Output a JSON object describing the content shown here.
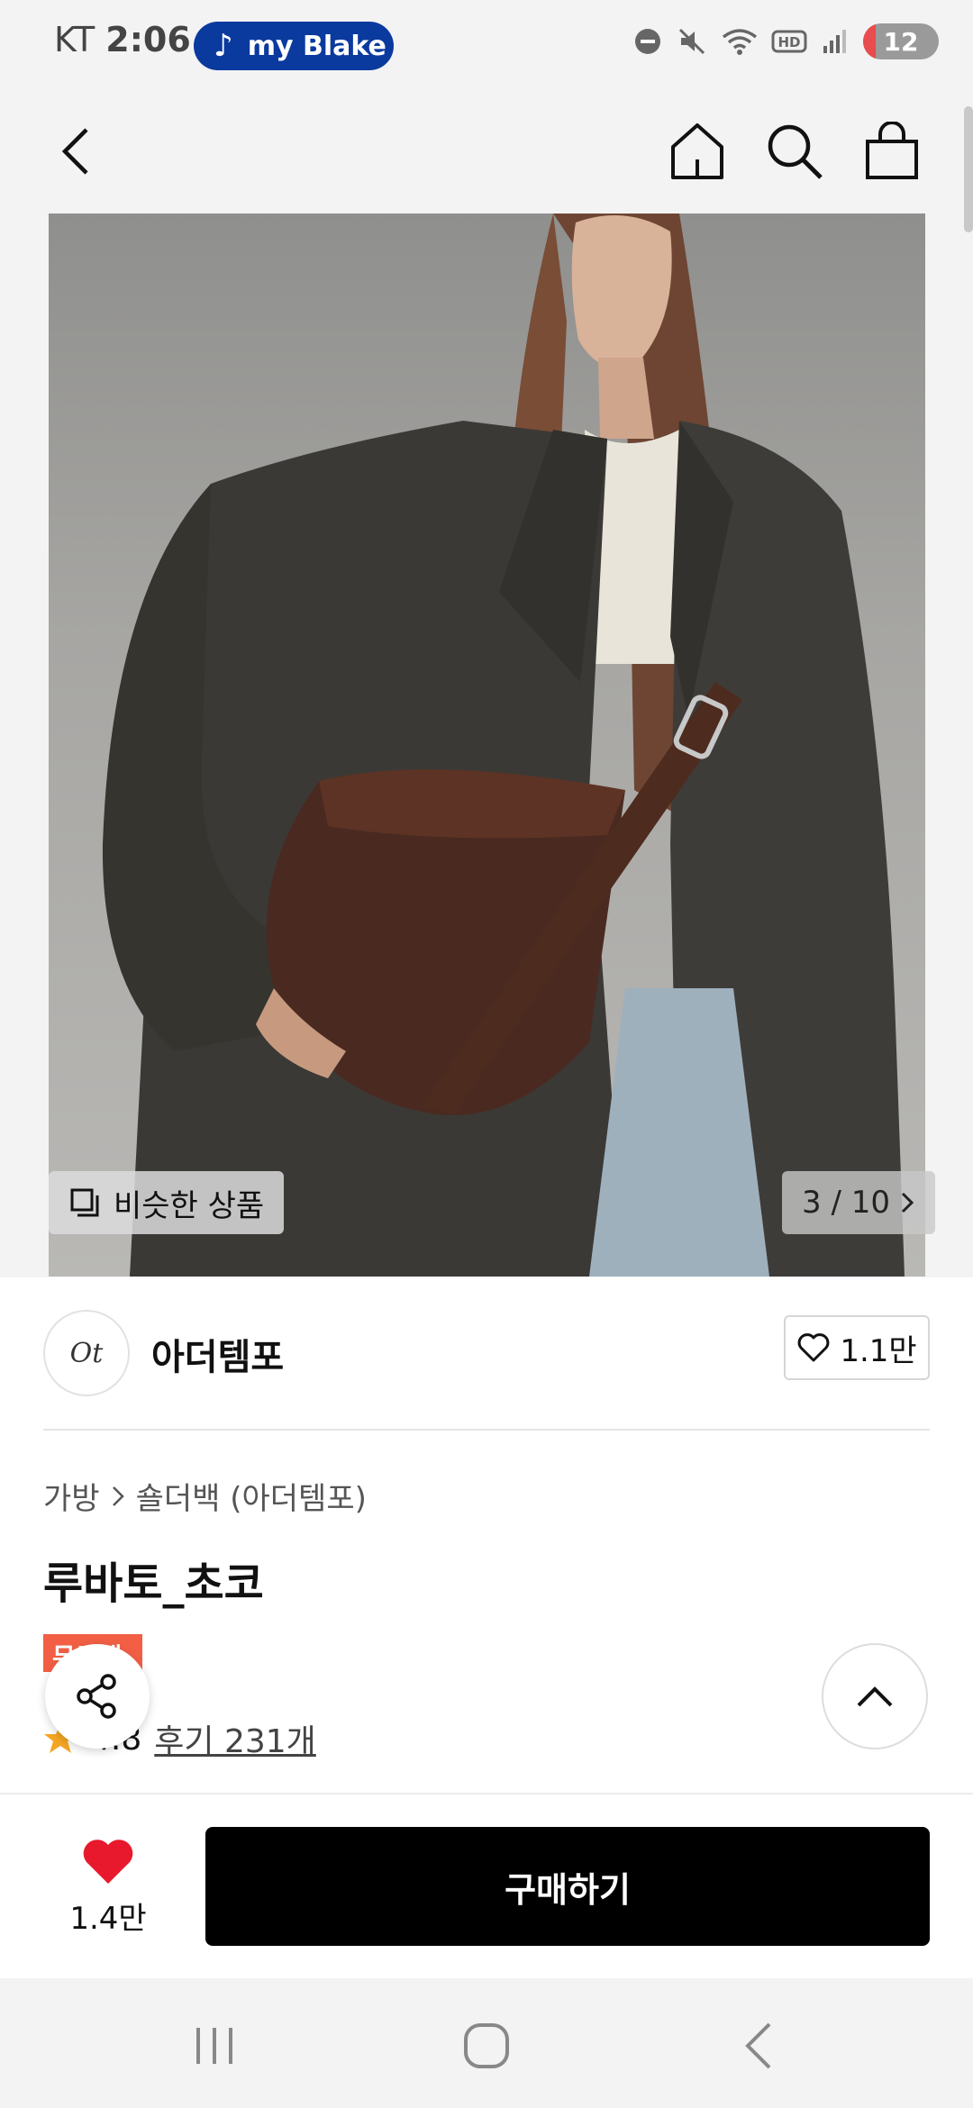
{
  "status_bar": {
    "carrier": "KT",
    "time": "2:06",
    "music_chip": "my Blake",
    "battery": "12"
  },
  "gallery": {
    "similar_label": "비슷한 상품",
    "counter": "3 / 10"
  },
  "brand": {
    "logo_text": "Ot",
    "name": "아더템포",
    "like_count": "1.1만"
  },
  "breadcrumb": {
    "category": "가방",
    "subcategory": "숄더백 (아더템포)"
  },
  "product": {
    "title": "루바토_초코",
    "badge": "무료배송",
    "rating": "4.8",
    "reviews": "후기 231개"
  },
  "purchase_bar": {
    "wish_count": "1.4만",
    "buy_label": "구매하기"
  },
  "colors": {
    "heart_red": "#e8192c",
    "badge_orange": "#f25f45",
    "music_chip_blue": "#0b3a9e",
    "buy_black": "#000000"
  }
}
